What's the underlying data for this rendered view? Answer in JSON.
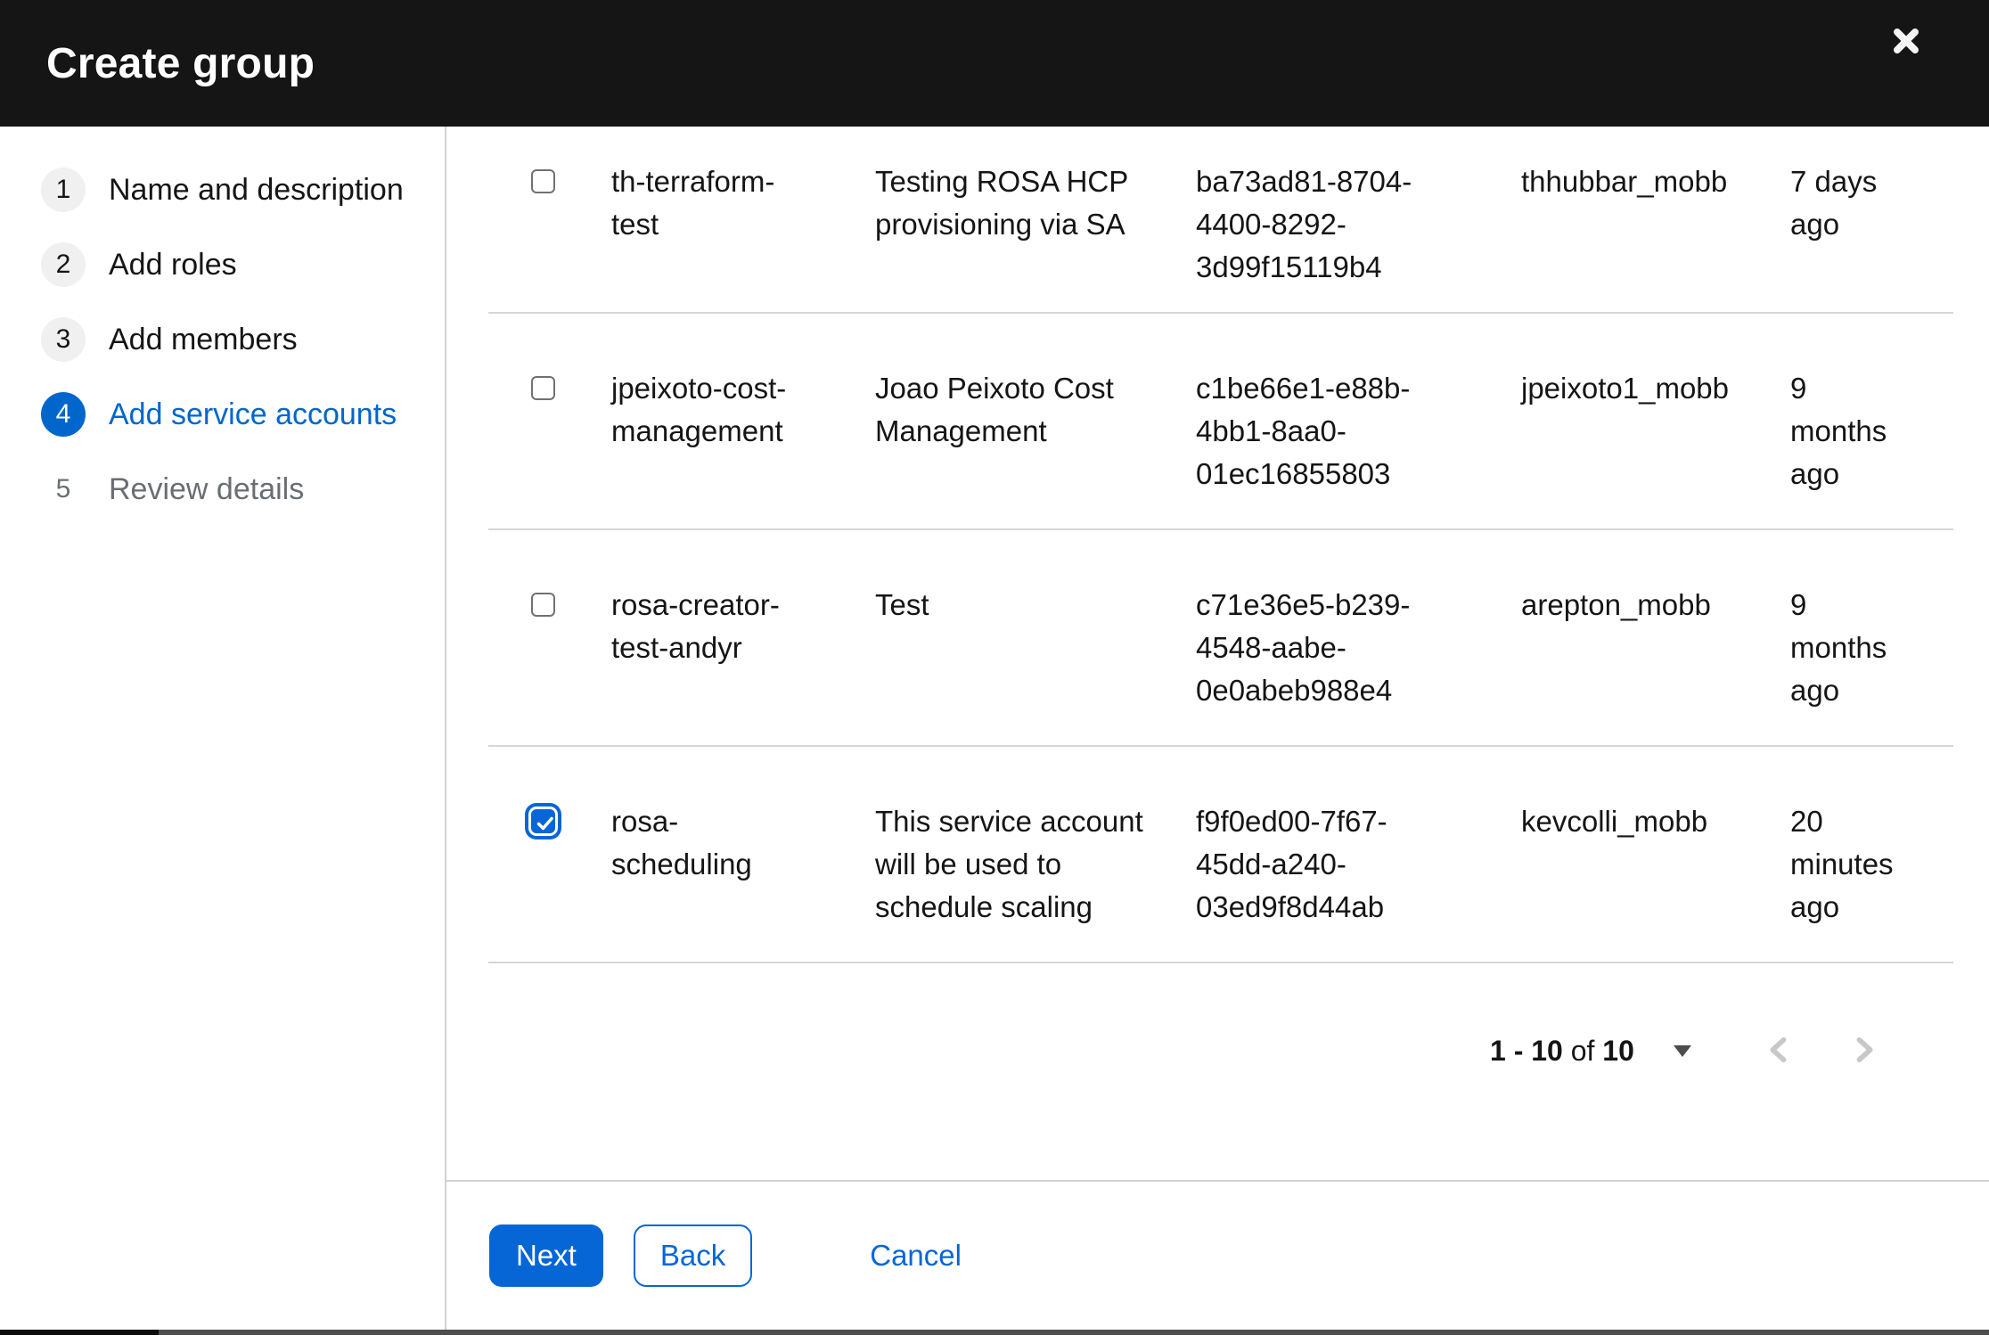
{
  "header": {
    "title": "Create group"
  },
  "steps": [
    {
      "number": "1",
      "label": "Name and description",
      "state": "default"
    },
    {
      "number": "2",
      "label": "Add roles",
      "state": "default"
    },
    {
      "number": "3",
      "label": "Add members",
      "state": "default"
    },
    {
      "number": "4",
      "label": "Add service accounts",
      "state": "current"
    },
    {
      "number": "5",
      "label": "Review details",
      "state": "disabled"
    }
  ],
  "table": {
    "rows": [
      {
        "checked": false,
        "name": "th-terraform-test",
        "description": "Testing ROSA HCP provisioning via SA",
        "client_id": "ba73ad81-8704-4400-8292-3d99f15119b4",
        "owner": "thhubbar_mobb",
        "time_created": "7 days ago"
      },
      {
        "checked": false,
        "name": "jpeixoto-cost-management",
        "description": "Joao Peixoto Cost Management",
        "client_id": "c1be66e1-e88b-4bb1-8aa0-01ec16855803",
        "owner": "jpeixoto1_mobb",
        "time_created": "9 months ago"
      },
      {
        "checked": false,
        "name": "rosa-creator-test-andyr",
        "description": "Test",
        "client_id": "c71e36e5-b239-4548-aabe-0e0abeb988e4",
        "owner": "arepton_mobb",
        "time_created": "9 months ago"
      },
      {
        "checked": true,
        "name": "rosa-scheduling",
        "description": "This service account will be used to schedule scaling",
        "client_id": "f9f0ed00-7f67-45dd-a240-03ed9f8d44ab",
        "owner": "kevcolli_mobb",
        "time_created": "20 minutes ago"
      }
    ]
  },
  "pagination": {
    "range": "1 - 10",
    "of": " of ",
    "total": "10"
  },
  "footer": {
    "next": "Next",
    "back": "Back",
    "cancel": "Cancel"
  },
  "colors": {
    "accent": "#0666d6",
    "header_bg": "#151515",
    "border": "#d2d2d2",
    "muted_text": "#6a6e73",
    "disabled_chevron": "#c8c8c8"
  }
}
